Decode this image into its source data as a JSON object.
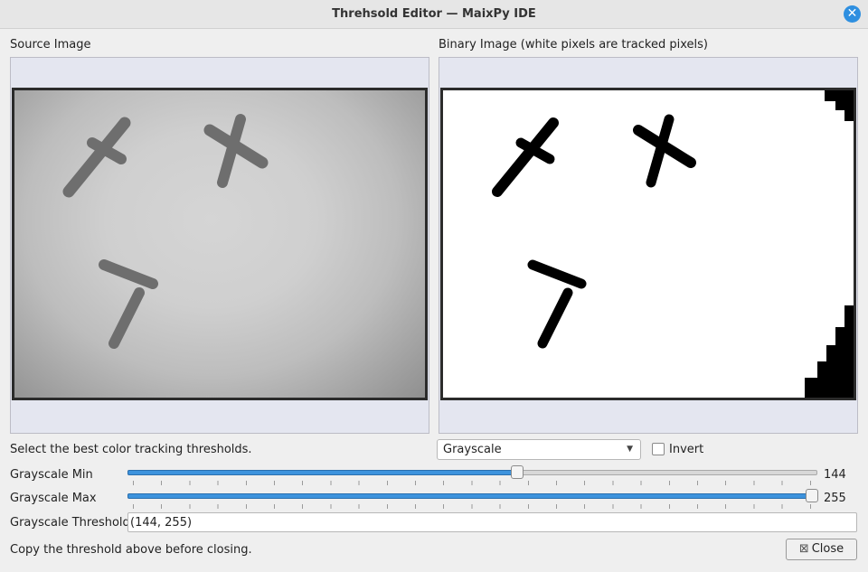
{
  "window": {
    "title": "Threhsold Editor — MaixPy IDE"
  },
  "panels": {
    "source_label": "Source Image",
    "binary_label": "Binary Image (white pixels are tracked pixels)"
  },
  "controls": {
    "instruction": "Select the best color tracking thresholds.",
    "mode_value": "Grayscale",
    "invert_label": "Invert",
    "invert_checked": false,
    "min_label": "Grayscale Min",
    "min_value": "144",
    "max_label": "Grayscale Max",
    "max_value": "255",
    "threshold_label": "Grayscale Threshold",
    "threshold_value": "(144, 255)"
  },
  "footer": {
    "hint": "Copy the threshold above before closing.",
    "close_label": "Close"
  },
  "icons": {
    "window_close": "close-circle-icon",
    "dropdown": "chevron-down-icon",
    "button_close": "close-x-icon"
  }
}
